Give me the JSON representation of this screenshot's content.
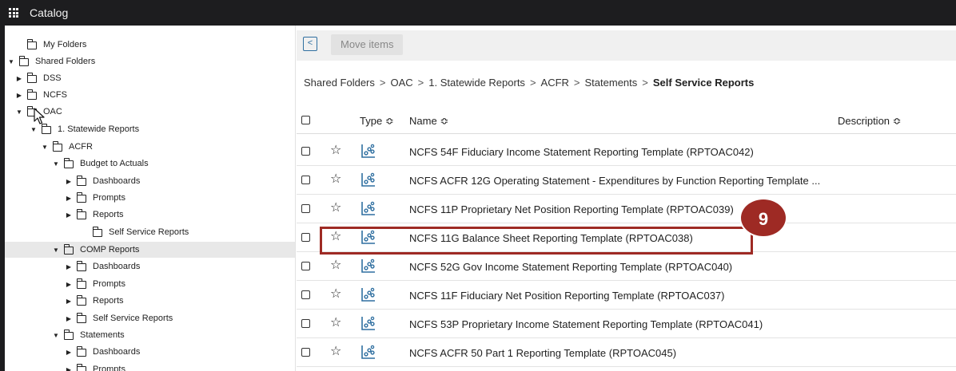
{
  "titlebar": {
    "title": "Catalog"
  },
  "tree": [
    {
      "label": "My Folders",
      "caret": "",
      "expanded": false,
      "selected": false
    },
    {
      "label": "Shared Folders",
      "caret": "▼",
      "expanded": true,
      "selected": false
    },
    {
      "label": "DSS",
      "caret": "▶",
      "expanded": false,
      "selected": false
    },
    {
      "label": "NCFS",
      "caret": "▶",
      "expanded": false,
      "selected": false
    },
    {
      "label": "OAC",
      "caret": "▼",
      "expanded": true,
      "selected": false
    },
    {
      "label": "1. Statewide Reports",
      "caret": "▼",
      "expanded": true,
      "selected": false
    },
    {
      "label": "ACFR",
      "caret": "▼",
      "expanded": true,
      "selected": false
    },
    {
      "label": "Budget to Actuals",
      "caret": "▼",
      "expanded": true,
      "selected": false
    },
    {
      "label": "Dashboards",
      "caret": "▶",
      "expanded": false,
      "selected": false
    },
    {
      "label": "Prompts",
      "caret": "▶",
      "expanded": false,
      "selected": false
    },
    {
      "label": "Reports",
      "caret": "▶",
      "expanded": false,
      "selected": false
    },
    {
      "label": "Self Service Reports",
      "caret": "",
      "expanded": false,
      "selected": false
    },
    {
      "label": "COMP Reports",
      "caret": "▼",
      "expanded": true,
      "selected": true
    },
    {
      "label": "Dashboards",
      "caret": "▶",
      "expanded": false,
      "selected": false
    },
    {
      "label": "Prompts",
      "caret": "▶",
      "expanded": false,
      "selected": false
    },
    {
      "label": "Reports",
      "caret": "▶",
      "expanded": false,
      "selected": false
    },
    {
      "label": "Self Service Reports",
      "caret": "▶",
      "expanded": false,
      "selected": false
    },
    {
      "label": "Statements",
      "caret": "▼",
      "expanded": true,
      "selected": false
    },
    {
      "label": "Dashboards",
      "caret": "▶",
      "expanded": false,
      "selected": false
    },
    {
      "label": "Prompts",
      "caret": "▶",
      "expanded": false,
      "selected": false
    }
  ],
  "toolbar": {
    "move_label": "Move items"
  },
  "breadcrumb": {
    "parts": [
      "Shared Folders",
      "OAC",
      "1. Statewide Reports",
      "ACFR",
      "Statements"
    ],
    "current": "Self Service Reports",
    "separator": ">"
  },
  "table": {
    "headers": {
      "type": "Type",
      "name": "Name",
      "description": "Description"
    },
    "sort_glyph": "≎",
    "rows": [
      {
        "name": "NCFS 54F Fiduciary Income Statement Reporting Template (RPTOAC042)"
      },
      {
        "name": "NCFS ACFR 12G Operating Statement - Expenditures by Function Reporting Template ..."
      },
      {
        "name": "NCFS 11P Proprietary Net Position Reporting Template (RPTOAC039)"
      },
      {
        "name": "NCFS 11G Balance Sheet Reporting Template (RPTOAC038)"
      },
      {
        "name": "NCFS 52G Gov Income Statement Reporting Template (RPTOAC040)"
      },
      {
        "name": "NCFS 11F Fiduciary Net Position Reporting Template (RPTOAC037)"
      },
      {
        "name": "NCFS 53P Proprietary Income Statement Reporting Template (RPTOAC041)"
      },
      {
        "name": "NCFS ACFR 50 Part 1 Reporting Template (RPTOAC045)"
      }
    ]
  },
  "callout": {
    "step": "9"
  },
  "colors": {
    "accent": "#9e2a24",
    "icon_blue": "#2f6fa0",
    "titlebar": "#1d1d1f"
  }
}
